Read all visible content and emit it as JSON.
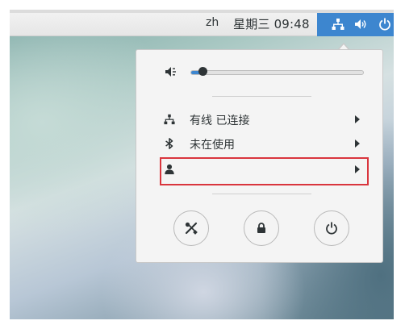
{
  "topbar": {
    "language": "zh",
    "clock": "星期三 09:48",
    "status_icons": [
      "network-wired-icon",
      "speaker-volume-icon",
      "power-icon"
    ]
  },
  "menu": {
    "volume": {
      "icon": "speaker-muted-icon",
      "level": 0.07
    },
    "items": [
      {
        "icon": "network-wired-icon",
        "label": "有线 已连接"
      },
      {
        "icon": "bluetooth-icon",
        "label": "未在使用"
      },
      {
        "icon": "user-icon",
        "label": ""
      }
    ],
    "actions": [
      {
        "icon": "settings-tools-icon"
      },
      {
        "icon": "lock-icon"
      },
      {
        "icon": "power-icon"
      }
    ]
  },
  "colors": {
    "accent": "#3d86cf",
    "highlight_border": "#d9353d",
    "menu_bg": "#f4f4f4",
    "text": "#2e3436"
  }
}
